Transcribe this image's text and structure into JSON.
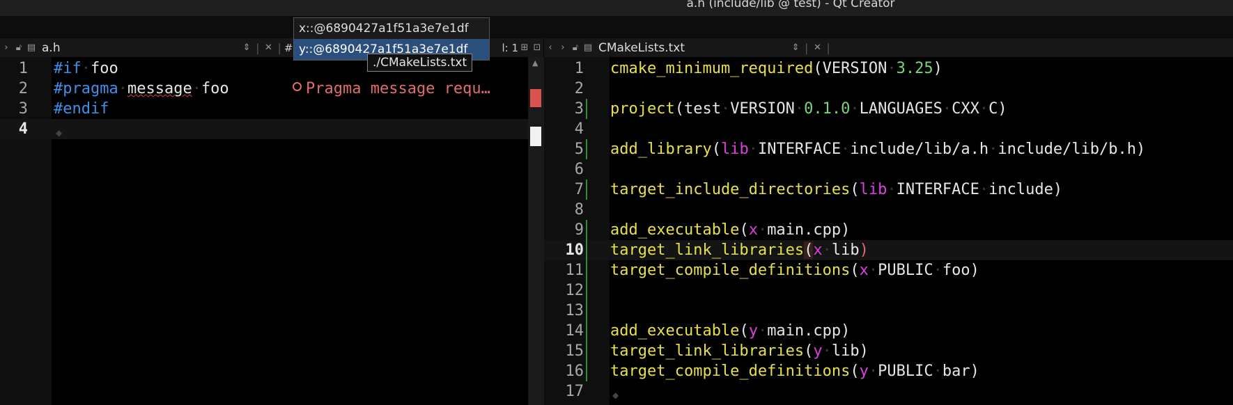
{
  "window": {
    "title": "a.h (include/lib @ test) - Qt Creator"
  },
  "left_toolbar": {
    "file_name": "a.h",
    "hash_label": "#",
    "position_label": "l: 1"
  },
  "right_toolbar": {
    "file_name": "CMakeLists.txt"
  },
  "popup": {
    "items": [
      "x::@6890427a1f51a3e7e1df",
      "y::@6890427a1f51a3e7e1df"
    ],
    "selected_index": 1
  },
  "tooltip": {
    "text": "./CMakeLists.txt"
  },
  "left_editor": {
    "line_numbers": [
      "1",
      "2",
      "3",
      "4"
    ],
    "current_line": 4,
    "diagnostic": "Pragma message requ…",
    "code": {
      "l1_kw": "#if",
      "l1_rest": "foo",
      "l2_kw": "#pragma",
      "l2_msg": "message",
      "l2_rest": "foo",
      "l3_kw": "#endif"
    }
  },
  "right_editor": {
    "line_numbers": [
      "1",
      "2",
      "3",
      "4",
      "5",
      "6",
      "7",
      "8",
      "9",
      "10",
      "11",
      "12",
      "13",
      "14",
      "15",
      "16",
      "17"
    ],
    "current_line": 10,
    "code": {
      "l1_fn": "cmake_minimum_required",
      "l1_a": "VERSION",
      "l1_num": "3.25",
      "l3_fn": "project",
      "l3_a": "test",
      "l3_b": "VERSION",
      "l3_num": "0.1.0",
      "l3_c": "LANGUAGES",
      "l3_d": "CXX",
      "l3_e": "C",
      "l5_fn": "add_library",
      "l5_tgt": "lib",
      "l5_a": "INTERFACE",
      "l5_b": "include/lib/a.h",
      "l5_c": "include/lib/b.h",
      "l7_fn": "target_include_directories",
      "l7_tgt": "lib",
      "l7_a": "INTERFACE",
      "l7_b": "include",
      "l9_fn": "add_executable",
      "l9_tgt": "x",
      "l9_a": "main.cpp",
      "l10_fn": "target_link_libraries",
      "l10_tgt": "x",
      "l10_a": "lib",
      "l11_fn": "target_compile_definitions",
      "l11_tgt": "x",
      "l11_a": "PUBLIC",
      "l11_b": "foo",
      "l14_fn": "add_executable",
      "l14_tgt": "y",
      "l14_a": "main.cpp",
      "l15_fn": "target_link_libraries",
      "l15_tgt": "y",
      "l15_a": "lib",
      "l16_fn": "target_compile_definitions",
      "l16_tgt": "y",
      "l16_a": "PUBLIC",
      "l16_b": "bar"
    }
  },
  "colors": {
    "preprocessor": "#3f8fe8",
    "function": "#e8e04a",
    "number": "#79d679",
    "target": "#dc40dc",
    "error": "#e06c6c",
    "selection": "#2a4f7d"
  }
}
